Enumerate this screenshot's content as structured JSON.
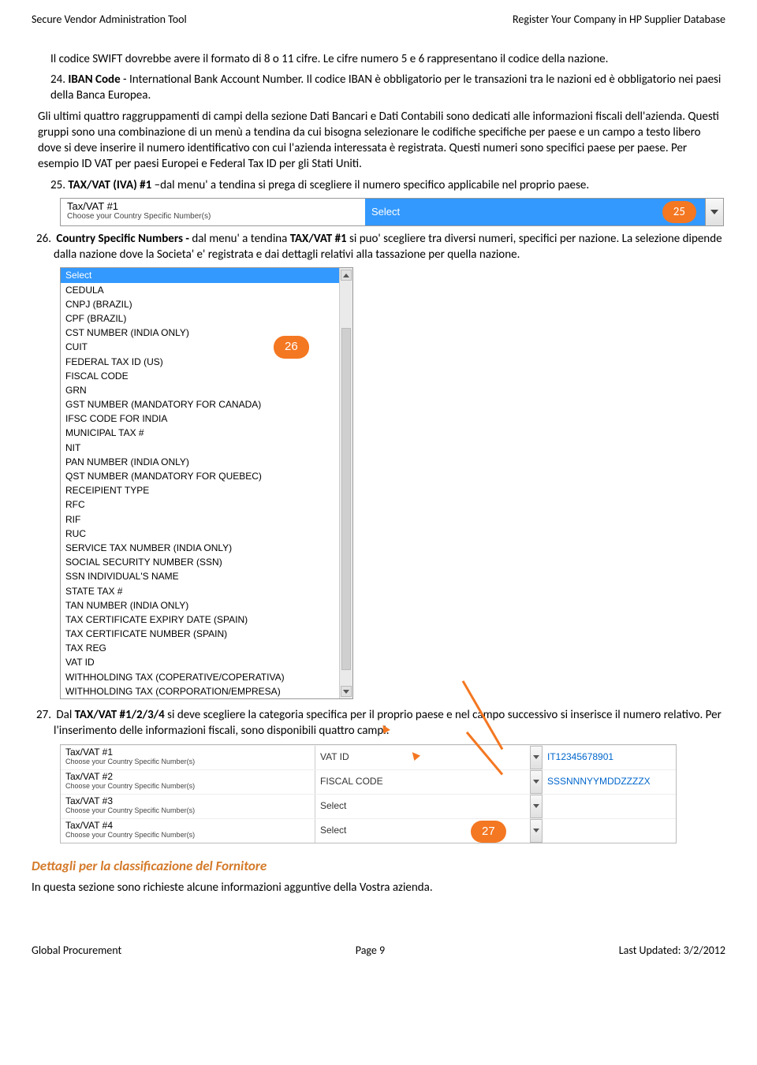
{
  "header": {
    "left": "Secure Vendor Administration Tool",
    "right": "Register Your Company in HP Supplier Database"
  },
  "intro": {
    "swift_line": "Il codice SWIFT dovrebbe avere il formato di 8 o 11 cifre. Le cifre numero 5 e 6  rappresentano il codice della nazione.",
    "item24_num": "24.",
    "item24_bold": "IBAN Code",
    "item24_rest": "  - International Bank Account Number.  Il codice IBAN è obbligatorio per le transazioni tra le nazioni ed è obbligatorio nei paesi della Banca Europea.",
    "para": "Gli ultimi quattro raggruppamenti di campi della sezione Dati Bancari e Dati Contabili sono dedicati alle informazioni fiscali dell'azienda. Questi gruppi sono una combinazione di un menù a tendina da cui bisogna selezionare le codifiche specifiche per paese e un campo a testo libero dove si deve inserire il numero identificativo con cui l'azienda interessata è registrata. Questi numeri sono specifici paese per paese. Per esempio ID VAT per paesi Europei e Federal Tax ID per gli Stati Uniti.",
    "item25_num": "25.",
    "item25_bold": "TAX/VAT (IVA) #1",
    "item25_rest": " –dal menu' a tendina si prega di scegliere il numero specifico applicabile nel proprio paese."
  },
  "taxSelect": {
    "label1": "Tax/VAT #1",
    "label2": "Choose your Country Specific Number(s)",
    "value": "Select",
    "badge": "25"
  },
  "item26": {
    "num": "26.",
    "bold1": "Country Specific Numbers -",
    "mid": " dal menu' a tendina   ",
    "bold2": "TAX/VAT #1",
    "rest": " si puo' scegliere tra diversi numeri, specifici per nazione. La selezione dipende dalla nazione dove la Societa' e' registrata e dai dettagli relativi alla tassazione per quella nazione."
  },
  "dropdown": {
    "badge": "26",
    "options": [
      "Select",
      "CEDULA",
      "CNPJ (BRAZIL)",
      "CPF (BRAZIL)",
      "CST NUMBER (INDIA ONLY)",
      "CUIT",
      "FEDERAL TAX ID (US)",
      "FISCAL CODE",
      "GRN",
      "GST NUMBER (MANDATORY FOR CANADA)",
      "IFSC CODE FOR INDIA",
      "MUNICIPAL TAX #",
      "NIT",
      "PAN NUMBER (INDIA ONLY)",
      "QST NUMBER (MANDATORY FOR QUEBEC)",
      "RECEIPIENT TYPE",
      "RFC",
      "RIF",
      "RUC",
      "SERVICE TAX NUMBER (INDIA ONLY)",
      "SOCIAL SECURITY NUMBER (SSN)",
      "SSN INDIVIDUAL'S NAME",
      "STATE TAX #",
      "TAN NUMBER (INDIA ONLY)",
      "TAX CERTIFICATE EXPIRY DATE (SPAIN)",
      "TAX CERTIFICATE NUMBER (SPAIN)",
      "TAX REG",
      "VAT ID",
      "WITHHOLDING TAX (COPERATIVE/COPERATIVA)",
      "WITHHOLDING TAX (CORPORATION/EMPRESA)"
    ]
  },
  "item27": {
    "num": "27.",
    "pre": "Dal ",
    "bold": "TAX/VAT #1/2/3/4",
    "rest": "  si deve scegliere la categoria specifica per il proprio paese e nel campo successivo si inserisce il numero relativo.  Per l'inserimento delle informazioni fiscali, sono disponibili quattro campi."
  },
  "taxTable": {
    "badge": "27",
    "rows": [
      {
        "t1": "Tax/VAT #1",
        "t2": "Choose your Country Specific Number(s)",
        "select": "VAT ID",
        "value": "IT12345678901",
        "link": true
      },
      {
        "t1": "Tax/VAT #2",
        "t2": "Choose your Country Specific Number(s)",
        "select": "FISCAL CODE",
        "value": "SSSNNNYYMDDZZZZX",
        "link": true
      },
      {
        "t1": "Tax/VAT #3",
        "t2": "Choose your Country Specific Number(s)",
        "select": "Select",
        "value": "",
        "link": false
      },
      {
        "t1": "Tax/VAT #4",
        "t2": "Choose your Country Specific Number(s)",
        "select": "Select",
        "value": "",
        "link": false
      }
    ]
  },
  "section": {
    "title": "Dettagli per la classificazione del Fornitore",
    "text": "In questa sezione sono richieste alcune informazioni agguntive della Vostra azienda."
  },
  "footer": {
    "left": "Global Procurement",
    "center": "Page 9",
    "right": "Last Updated: 3/2/2012"
  }
}
